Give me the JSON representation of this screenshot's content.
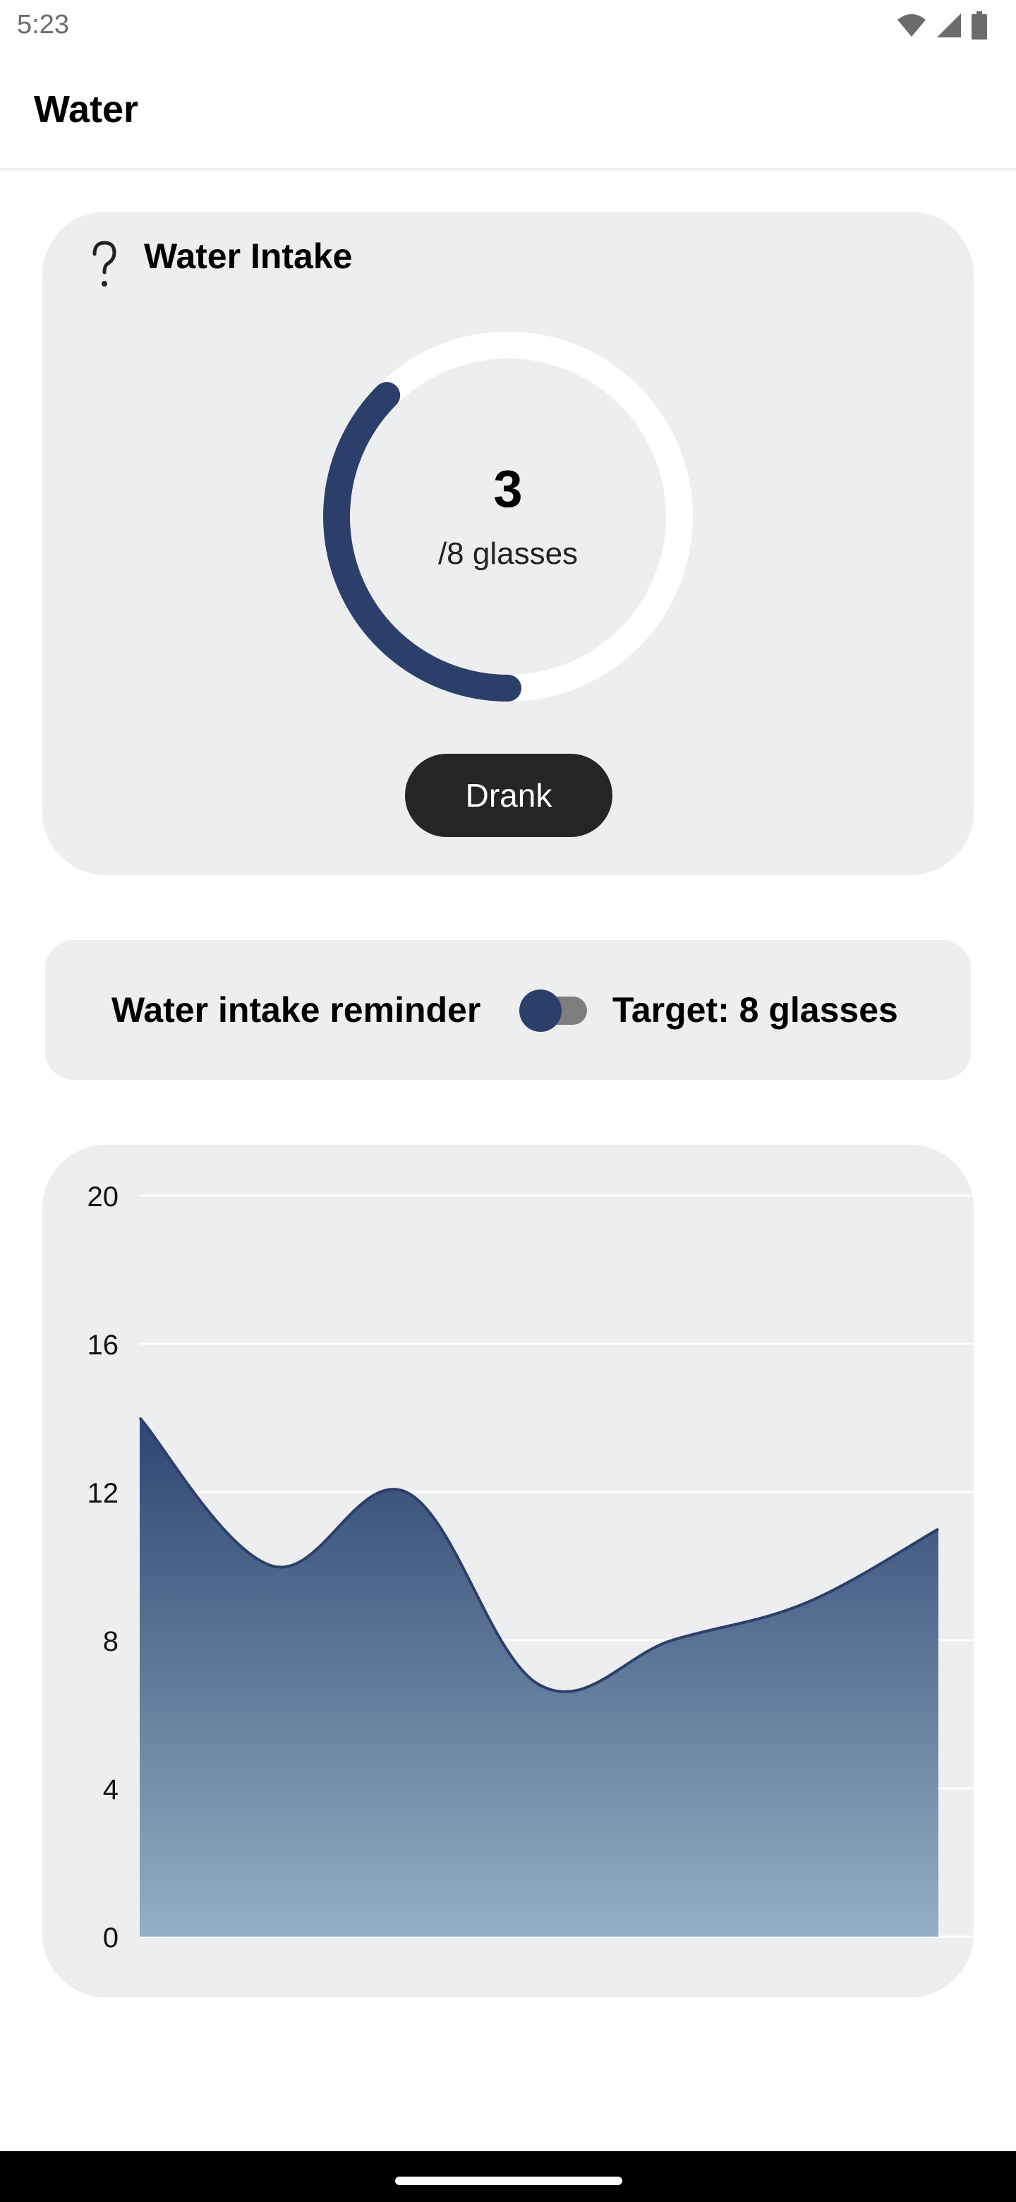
{
  "status_bar": {
    "time": "5:23",
    "icons": [
      "wifi-icon",
      "signal-icon",
      "battery-icon"
    ]
  },
  "app_bar": {
    "title": "Water"
  },
  "intake": {
    "title": "Water Intake",
    "help_icon": "help-icon",
    "current": "3",
    "goal_label": "/8 glasses",
    "progress_fraction": 0.375,
    "button_label": "Drank",
    "colors": {
      "progress": "#2c3f6a",
      "track": "#ffffff",
      "button": "#252525"
    }
  },
  "reminder": {
    "label": "Water intake reminder",
    "toggle_on": false,
    "target_label": "Target: 8 glasses"
  },
  "chart_data": {
    "type": "area",
    "x": [
      0,
      1,
      2,
      3,
      4,
      5,
      6
    ],
    "series": [
      {
        "values": [
          14,
          10,
          12,
          6.8,
          8,
          9,
          11
        ]
      }
    ],
    "ylim": [
      0,
      20
    ],
    "yticks": [
      "20",
      "16",
      "12",
      "8",
      "4",
      "0"
    ],
    "grid": true,
    "colors": {
      "line": "#2c3f6a",
      "fill_top": "#2f4572",
      "fill_bottom": "#93afc3"
    }
  }
}
